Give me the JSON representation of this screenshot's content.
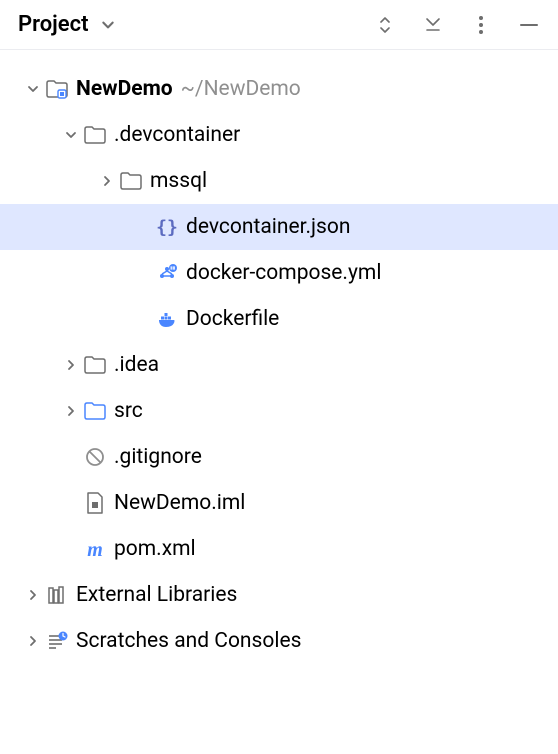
{
  "header": {
    "title": "Project"
  },
  "tree": {
    "root": {
      "name": "NewDemo",
      "path": "~/NewDemo"
    },
    "devcontainer": {
      "name": ".devcontainer",
      "mssql": "mssql",
      "json": "devcontainer.json",
      "compose": "docker-compose.yml",
      "dockerfile": "Dockerfile"
    },
    "idea": ".idea",
    "src": "src",
    "gitignore": ".gitignore",
    "iml": "NewDemo.iml",
    "pom": "pom.xml",
    "extlib": "External Libraries",
    "scratches": "Scratches and Consoles"
  }
}
